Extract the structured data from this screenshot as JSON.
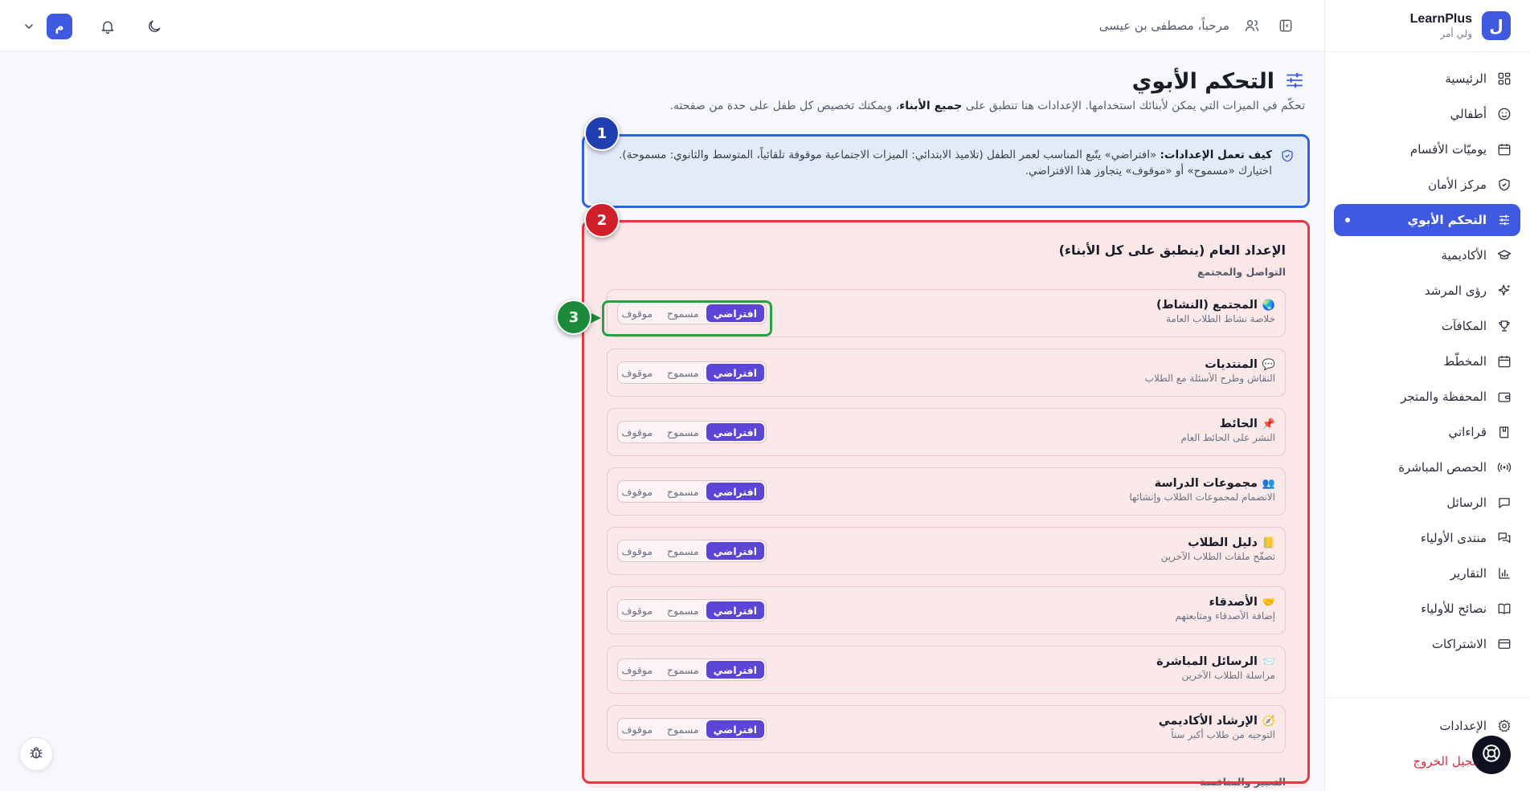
{
  "topbar": {
    "user_initial": "م",
    "greeting": "مرحباً، مصطفى بن عيسى"
  },
  "brand": {
    "logo_letter": "ل",
    "name": "LearnPlus",
    "role": "ولي أمر"
  },
  "sidebar": {
    "items": [
      {
        "label": "الرئيسية",
        "icon": "grid-icon"
      },
      {
        "label": "أطفالي",
        "icon": "smile-icon"
      },
      {
        "label": "يوميّات الأقسام",
        "icon": "calendar-icon"
      },
      {
        "label": "مركز الأمان",
        "icon": "shield-icon"
      },
      {
        "label": "التحكم الأبوي",
        "icon": "sliders-icon",
        "active": true
      },
      {
        "label": "الأكاديمية",
        "icon": "graduation-cap-icon"
      },
      {
        "label": "رؤى المرشد",
        "icon": "sparkles-icon"
      },
      {
        "label": "المكافآت",
        "icon": "trophy-icon"
      },
      {
        "label": "المخطّط",
        "icon": "calendar-icon"
      },
      {
        "label": "المحفظة والمتجر",
        "icon": "wallet-icon"
      },
      {
        "label": "قراءاتي",
        "icon": "book-icon"
      },
      {
        "label": "الحصص المباشرة",
        "icon": "broadcast-icon"
      },
      {
        "label": "الرسائل",
        "icon": "message-icon"
      },
      {
        "label": "منتدى الأولياء",
        "icon": "chat-icon"
      },
      {
        "label": "التقارير",
        "icon": "bar-chart-icon"
      },
      {
        "label": "نصائح للأولياء",
        "icon": "open-book-icon"
      },
      {
        "label": "الاشتراكات",
        "icon": "credit-card-icon"
      }
    ],
    "settings_label": "الإعدادات",
    "logout_label": "تسجيل الخروج"
  },
  "page": {
    "title": "التحكم الأبوي",
    "subtitle_part1": "تحكّم في الميزات التي يمكن لأبنائك استخدامها. الإعدادات هنا تنطبق على ",
    "subtitle_bold": "جميع الأبناء",
    "subtitle_part2": "، ويمكنك تخصيص كل طفل على حدة من صفحته."
  },
  "info": {
    "bold": "كيف تعمل الإعدادات:",
    "line1": " «افتراضي» يتّبع المناسب لعمر الطفل (تلاميذ الابتدائي: الميزات الاجتماعية موقوفة تلقائياً، المتوسط والثانوي: مسموحة).",
    "line2": "اختيارك «مسموح» أو «موقوف» يتجاوز هذا الافتراضي."
  },
  "section": {
    "title": "الإعداد العام (ينطبق على كل الأبناء)",
    "group1": "التواصل والمجتمع",
    "group2": "التعبير والمنافسة",
    "options": [
      "افتراضي",
      "مسموح",
      "موقوف"
    ],
    "rows": [
      {
        "emoji": "🌏",
        "title": "المجتمع (النشاط)",
        "desc": "خلاصة نشاط الطلاب العامة",
        "selected": "افتراضي"
      },
      {
        "emoji": "💬",
        "title": "المنتديات",
        "desc": "النقاش وطرح الأسئلة مع الطلاب",
        "selected": "افتراضي"
      },
      {
        "emoji": "📌",
        "title": "الحائط",
        "desc": "النشر على الحائط العام",
        "selected": "افتراضي"
      },
      {
        "emoji": "👥",
        "title": "مجموعات الدراسة",
        "desc": "الانضمام لمجموعات الطلاب وإنشائها",
        "selected": "افتراضي"
      },
      {
        "emoji": "📒",
        "title": "دليل الطلاب",
        "desc": "تصفّح ملفات الطلاب الآخرين",
        "selected": "افتراضي"
      },
      {
        "emoji": "🤝",
        "title": "الأصدقاء",
        "desc": "إضافة الأصدقاء ومتابعتهم",
        "selected": "افتراضي"
      },
      {
        "emoji": "📨",
        "title": "الرسائل المباشرة",
        "desc": "مراسلة الطلاب الآخرين",
        "selected": "افتراضي"
      },
      {
        "emoji": "🧭",
        "title": "الإرشاد الأكاديمي",
        "desc": "التوجيه من طلاب أكبر سناً",
        "selected": "افتراضي"
      }
    ]
  },
  "annotations": [
    "1",
    "2",
    "3"
  ],
  "colors": {
    "brand": "#3f5ae0",
    "selected_segment": "#5b45d6",
    "annotation_blue": "#2e63db",
    "annotation_red": "#e23a3e",
    "annotation_green": "#25a244",
    "logout": "#e02a3a"
  }
}
